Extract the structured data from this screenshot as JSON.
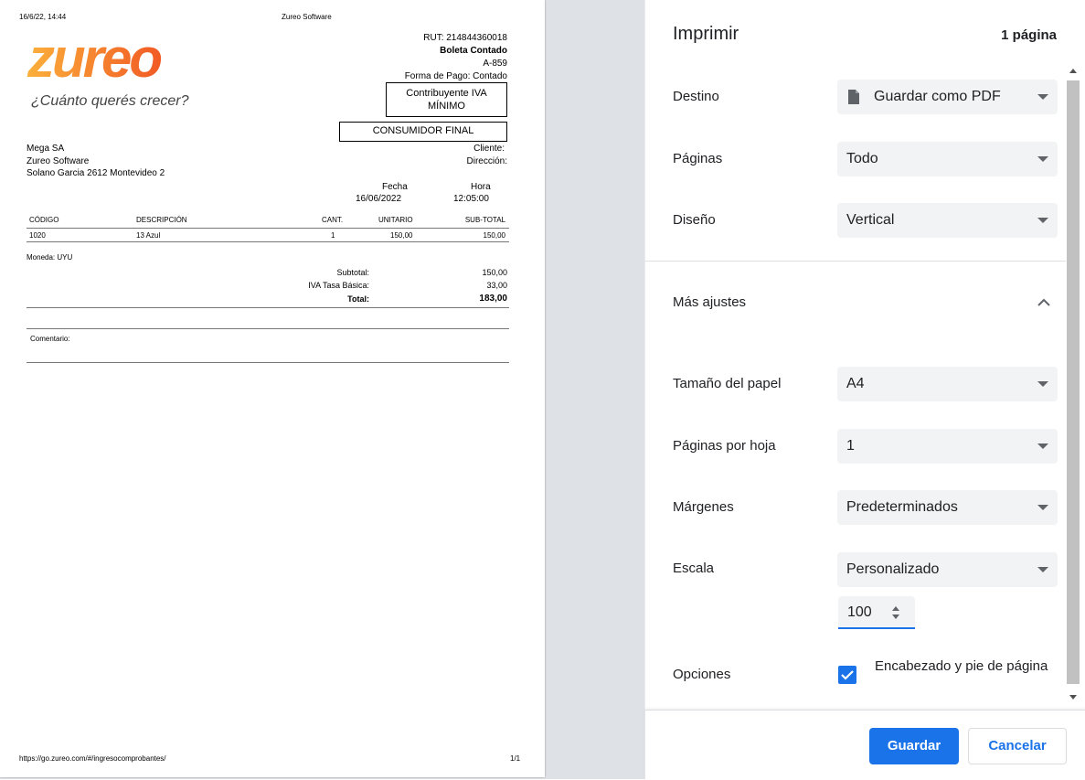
{
  "document": {
    "header_left": "16/6/22, 14:44",
    "header_center": "Zureo Software",
    "logo_text": "zureo",
    "tagline": "¿Cuánto querés crecer?",
    "rut": "RUT: 214844360018",
    "doc_type": "Boleta Contado",
    "doc_number": "A-859",
    "payment": "Forma de Pago: Contado",
    "iva_box_line1": "Contribuyente IVA",
    "iva_box_line2": "MÍNIMO",
    "consumer_box": "CONSUMIDOR FINAL",
    "company": "Mega SA",
    "software": "Zureo Software",
    "address": "Solano Garcia 2612 Montevideo 2",
    "client_label": "Cliente:",
    "address_label": "Dirección:",
    "date_label": "Fecha",
    "date_value": "16/06/2022",
    "time_label": "Hora",
    "time_value": "12:05:00",
    "columns": [
      "CÓDIGO",
      "DESCRIPCIÓN",
      "CANT.",
      "UNITARIO",
      "SUB-TOTAL"
    ],
    "rows": [
      [
        "1020",
        "13 Azul",
        "1",
        "150,00",
        "150,00"
      ]
    ],
    "currency": "Moneda: UYU",
    "subtotal_label": "Subtotal:",
    "subtotal_value": "150,00",
    "iva_label": "IVA Tasa Básica:",
    "iva_value": "33,00",
    "total_label": "Total:",
    "total_value": "183,00",
    "comment_label": "Comentario:",
    "footer_url": "https://go.zureo.com/#/ingresocomprobantes/",
    "footer_page": "1/1"
  },
  "print_panel": {
    "title": "Imprimir",
    "page_count": "1 página",
    "destino_label": "Destino",
    "destino_value": "Guardar como PDF",
    "paginas_label": "Páginas",
    "paginas_value": "Todo",
    "diseno_label": "Diseño",
    "diseno_value": "Vertical",
    "mas_ajustes_label": "Más ajustes",
    "tamano_label": "Tamaño del papel",
    "tamano_value": "A4",
    "por_hoja_label": "Páginas por hoja",
    "por_hoja_value": "1",
    "margenes_label": "Márgenes",
    "margenes_value": "Predeterminados",
    "escala_label": "Escala",
    "escala_value": "Personalizado",
    "escala_number": "100",
    "opciones_label": "Opciones",
    "encabezado_label": "Encabezado y pie de página",
    "save_label": "Guardar",
    "cancel_label": "Cancelar"
  },
  "colors": {
    "accent": "#1a73e8",
    "logo_orange": "#f7931e"
  }
}
